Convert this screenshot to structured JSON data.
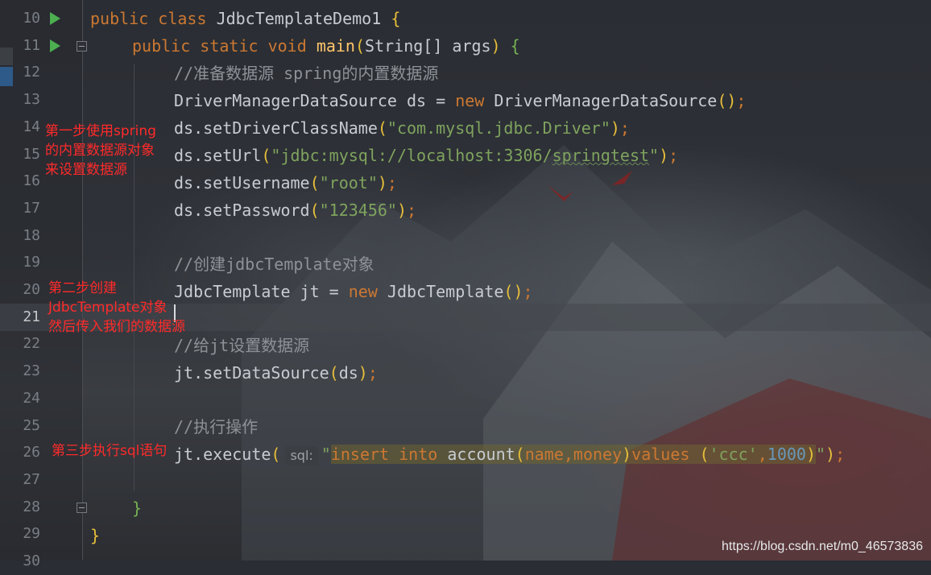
{
  "editor": {
    "lines": [
      {
        "num": "10",
        "run": true
      },
      {
        "num": "11",
        "run": true,
        "fold": true
      },
      {
        "num": "12"
      },
      {
        "num": "13"
      },
      {
        "num": "14"
      },
      {
        "num": "15"
      },
      {
        "num": "16"
      },
      {
        "num": "17"
      },
      {
        "num": "18"
      },
      {
        "num": "19"
      },
      {
        "num": "20"
      },
      {
        "num": "21",
        "current": true
      },
      {
        "num": "22"
      },
      {
        "num": "23"
      },
      {
        "num": "24"
      },
      {
        "num": "25"
      },
      {
        "num": "26"
      },
      {
        "num": "27"
      },
      {
        "num": "28",
        "fold": true
      },
      {
        "num": "29"
      },
      {
        "num": "30"
      }
    ],
    "code": {
      "l10": {
        "public": "public",
        "class": "class",
        "name": "JdbcTemplateDemo1",
        "brace": "{"
      },
      "l11": {
        "public": "public",
        "static": "static",
        "void": "void",
        "method": "main",
        "lp": "(",
        "params": "String[] args",
        "rp": ")",
        "brace": "{"
      },
      "l12": {
        "comment": "//准备数据源 spring的内置数据源"
      },
      "l13": {
        "decl": "DriverManagerDataSource ds = ",
        "new": "new",
        "ctor": " DriverManagerDataSource",
        "paren": "()",
        "semi": ";"
      },
      "l14": {
        "call": "ds.setDriverClassName",
        "lp": "(",
        "str": "\"com.mysql.jdbc.Driver\"",
        "rp": ")",
        "semi": ";"
      },
      "l15": {
        "call": "ds.setUrl",
        "lp": "(",
        "str_a": "\"jdbc:mysql://localhost:3306/",
        "str_b": "springtest",
        "str_c": "\"",
        "rp": ")",
        "semi": ";"
      },
      "l16": {
        "call": "ds.setUsername",
        "lp": "(",
        "str": "\"root\"",
        "rp": ")",
        "semi": ";"
      },
      "l17": {
        "call": "ds.setPassword",
        "lp": "(",
        "str": "\"123456\"",
        "rp": ")",
        "semi": ";"
      },
      "l19": {
        "comment": "//创建jdbcTemplate对象"
      },
      "l20": {
        "decl": "JdbcTemplate jt = ",
        "new": "new",
        "ctor": " JdbcTemplate",
        "paren": "()",
        "semi": ";"
      },
      "l22": {
        "comment": "//给jt设置数据源"
      },
      "l23": {
        "call": "jt.setDataSource",
        "lp": "(",
        "arg": "ds",
        "rp": ")",
        "semi": ";"
      },
      "l25": {
        "comment": "//执行操作"
      },
      "l26": {
        "call": "jt.execute",
        "lp": "(",
        "hint": "sql:",
        "q1": "\"",
        "ins": "insert",
        "into": "into",
        "tbl": "account",
        "p1": "(",
        "cols": "name,money",
        "p2": ")",
        "values": "values",
        "p3": "(",
        "v1": "'ccc'",
        "comma": ",",
        "v2": "1000",
        "p4": ")",
        "q2": "\"",
        "rp": ")",
        "semi": ";"
      },
      "l28": {
        "brace": "}"
      },
      "l29": {
        "brace": "}"
      }
    }
  },
  "annotations": {
    "step1": [
      "第一步使用spring",
      "的内置数据源对象",
      "来设置数据源"
    ],
    "step2": [
      "第二步创建",
      "JdbcTemplate对象",
      "然后传入我们的数据源"
    ],
    "step3": [
      "第三步执行sql语句"
    ]
  },
  "watermark": "https://blog.csdn.net/m0_46573836",
  "colors": {
    "keyword": "#cc7832",
    "method": "#ffc66d",
    "string": "#7fa35e",
    "comment": "#8e9297",
    "number": "#6897bb",
    "annotation": "#ff2a2a",
    "run_icon": "#4caf50"
  }
}
